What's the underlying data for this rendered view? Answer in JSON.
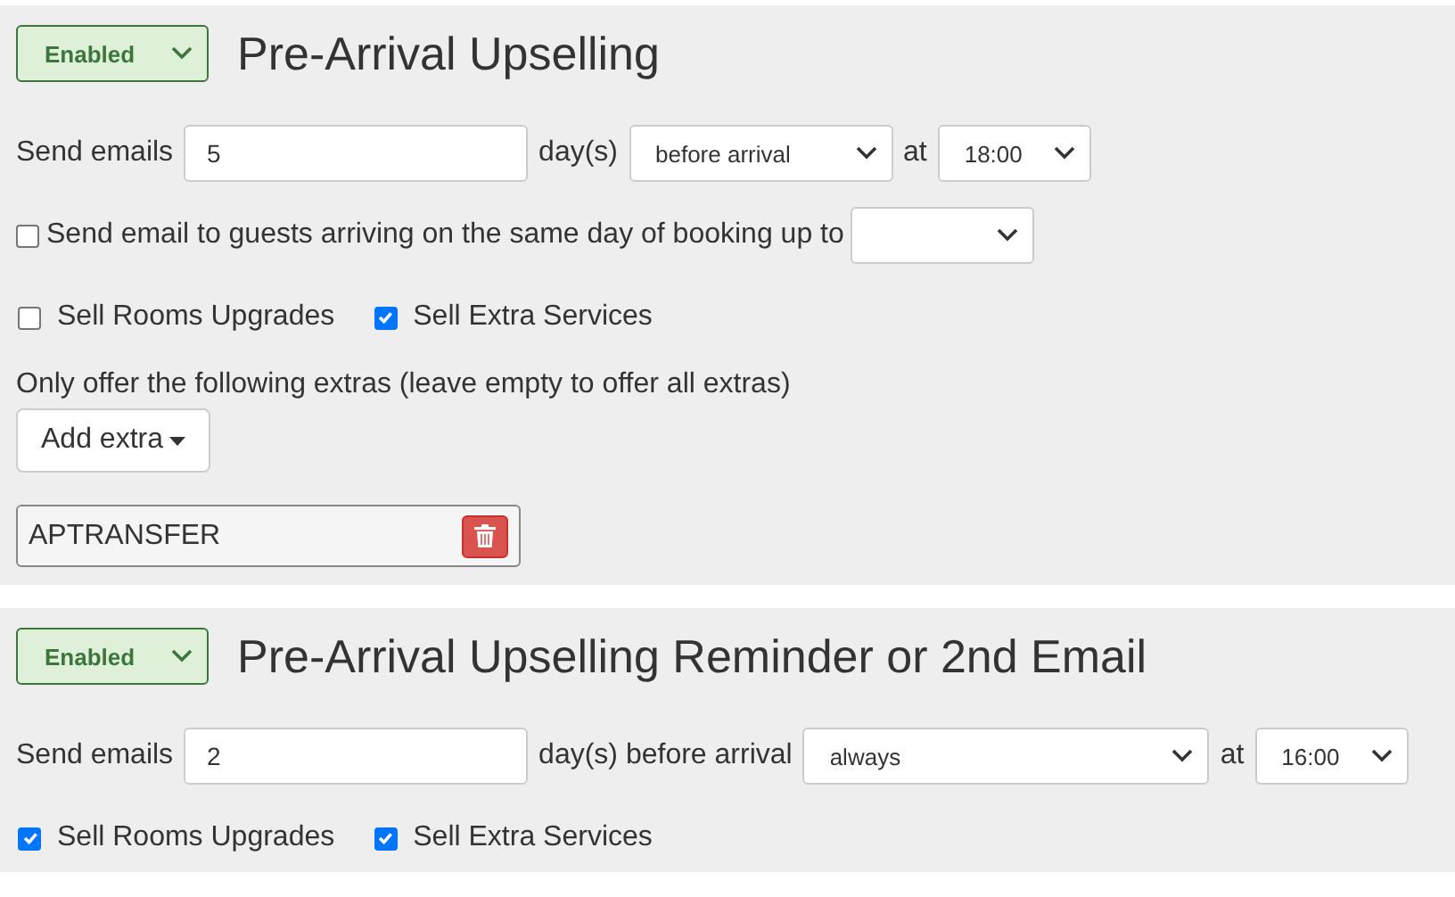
{
  "sections": [
    {
      "status": "Enabled",
      "title": "Pre-Arrival Upselling",
      "send_row": [
        {
          "kind": "text",
          "text": "Send emails"
        },
        {
          "kind": "input",
          "value": "5"
        },
        {
          "kind": "text",
          "text": "day(s)"
        },
        {
          "kind": "select",
          "value": "before arrival"
        },
        {
          "kind": "text",
          "text": "at"
        },
        {
          "kind": "select",
          "value": "18:00"
        }
      ],
      "same_day": {
        "label": "Send email to guests arriving on the same day of booking up to",
        "checked": false
      },
      "checkboxes": [
        {
          "label": "Sell Rooms Upgrades",
          "checked": false
        },
        {
          "label": "Sell Extra Services",
          "checked": true
        }
      ],
      "extras": {
        "label": "Only offer the following extras (leave empty to offer all extras)",
        "button": "Add extra",
        "items": [
          {
            "name": "APTRANSFER"
          }
        ]
      }
    },
    {
      "status": "Enabled",
      "title": "Pre-Arrival Upselling Reminder or 2nd Email",
      "send_row": [
        {
          "kind": "text",
          "text": "Send emails"
        },
        {
          "kind": "input",
          "value": "2"
        },
        {
          "kind": "text",
          "text": "day(s) before arrival"
        },
        {
          "kind": "select",
          "value": "always"
        },
        {
          "kind": "text",
          "text": "at"
        },
        {
          "kind": "select",
          "value": "16:00"
        }
      ],
      "checkboxes": [
        {
          "label": "Sell Rooms Upgrades",
          "checked": true
        },
        {
          "label": "Sell Extra Services",
          "checked": true
        }
      ]
    }
  ]
}
